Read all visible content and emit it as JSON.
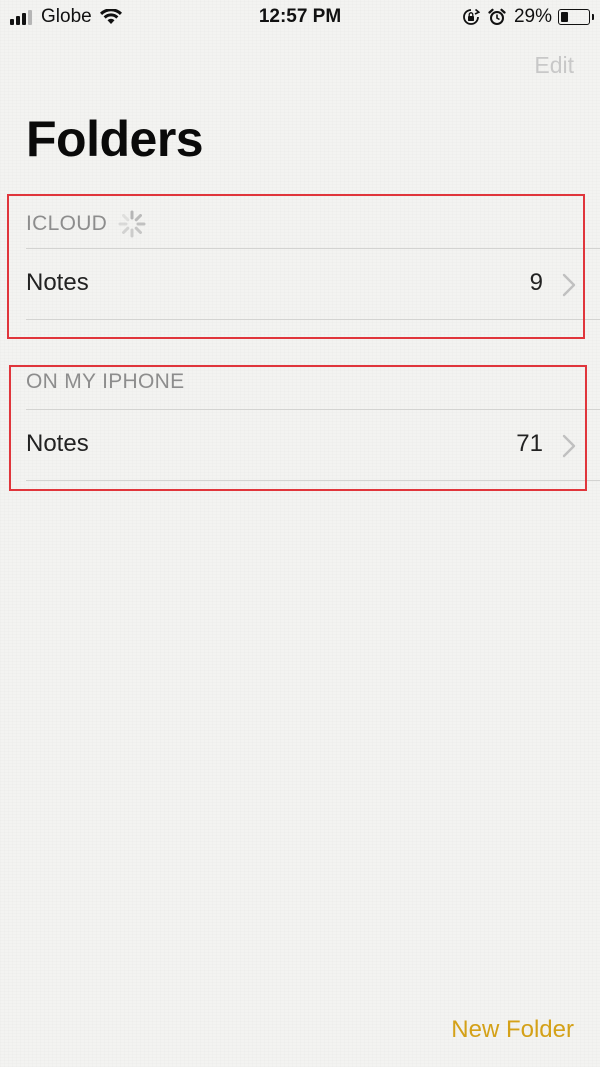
{
  "status_bar": {
    "carrier": "Globe",
    "time": "12:57 PM",
    "battery_percent": "29%",
    "battery_level": 0.29,
    "signal_bars_filled": 3,
    "signal_bars_total": 4,
    "icons": [
      "signal-icon",
      "wifi-icon",
      "rotation-lock-icon",
      "alarm-icon",
      "battery-icon"
    ]
  },
  "nav": {
    "edit_label": "Edit",
    "title": "Folders"
  },
  "sections": [
    {
      "header": "ICLOUD",
      "loading": true,
      "folders": [
        {
          "name": "Notes",
          "count": "9"
        }
      ]
    },
    {
      "header": "ON MY IPHONE",
      "loading": false,
      "folders": [
        {
          "name": "Notes",
          "count": "71"
        }
      ]
    }
  ],
  "toolbar": {
    "new_folder_label": "New Folder"
  },
  "colors": {
    "accent": "#d4a118",
    "highlight": "#e0353b",
    "header_text": "#8d8d8d",
    "disabled": "#c8c8c8"
  }
}
